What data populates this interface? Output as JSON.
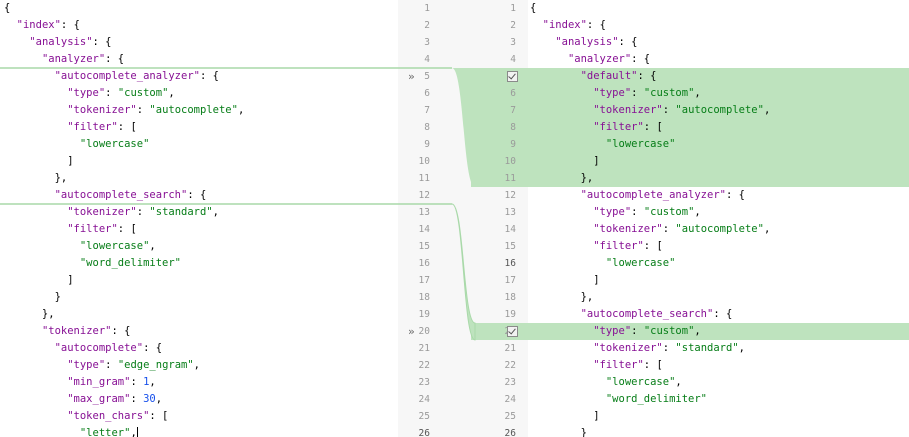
{
  "left": {
    "lines": [
      [
        [
          "p",
          "{"
        ]
      ],
      [
        [
          "p",
          "  "
        ],
        [
          "k",
          "\"index\""
        ],
        [
          "p",
          ": {"
        ]
      ],
      [
        [
          "p",
          "    "
        ],
        [
          "k",
          "\"analysis\""
        ],
        [
          "p",
          ": {"
        ]
      ],
      [
        [
          "p",
          "      "
        ],
        [
          "k",
          "\"analyzer\""
        ],
        [
          "p",
          ": {"
        ]
      ],
      [
        [
          "p",
          "        "
        ],
        [
          "k",
          "\"autocomplete_analyzer\""
        ],
        [
          "p",
          ": {"
        ]
      ],
      [
        [
          "p",
          "          "
        ],
        [
          "k",
          "\"type\""
        ],
        [
          "p",
          ": "
        ],
        [
          "s",
          "\"custom\""
        ],
        [
          "p",
          ","
        ]
      ],
      [
        [
          "p",
          "          "
        ],
        [
          "k",
          "\"tokenizer\""
        ],
        [
          "p",
          ": "
        ],
        [
          "s",
          "\"autocomplete\""
        ],
        [
          "p",
          ","
        ]
      ],
      [
        [
          "p",
          "          "
        ],
        [
          "k",
          "\"filter\""
        ],
        [
          "p",
          ": ["
        ]
      ],
      [
        [
          "p",
          "            "
        ],
        [
          "s",
          "\"lowercase\""
        ]
      ],
      [
        [
          "p",
          "          ]"
        ]
      ],
      [
        [
          "p",
          "        },"
        ]
      ],
      [
        [
          "p",
          "        "
        ],
        [
          "k",
          "\"autocomplete_search\""
        ],
        [
          "p",
          ": {"
        ]
      ],
      [
        [
          "p",
          "          "
        ],
        [
          "k",
          "\"tokenizer\""
        ],
        [
          "p",
          ": "
        ],
        [
          "s",
          "\"standard\""
        ],
        [
          "p",
          ","
        ]
      ],
      [
        [
          "p",
          "          "
        ],
        [
          "k",
          "\"filter\""
        ],
        [
          "p",
          ": ["
        ]
      ],
      [
        [
          "p",
          "            "
        ],
        [
          "s",
          "\"lowercase\""
        ],
        [
          "p",
          ","
        ]
      ],
      [
        [
          "p",
          "            "
        ],
        [
          "s",
          "\"word_delimiter\""
        ]
      ],
      [
        [
          "p",
          "          ]"
        ]
      ],
      [
        [
          "p",
          "        }"
        ]
      ],
      [
        [
          "p",
          "      },"
        ]
      ],
      [
        [
          "p",
          "      "
        ],
        [
          "k",
          "\"tokenizer\""
        ],
        [
          "p",
          ": {"
        ]
      ],
      [
        [
          "p",
          "        "
        ],
        [
          "k",
          "\"autocomplete\""
        ],
        [
          "p",
          ": {"
        ]
      ],
      [
        [
          "p",
          "          "
        ],
        [
          "k",
          "\"type\""
        ],
        [
          "p",
          ": "
        ],
        [
          "s",
          "\"edge_ngram\""
        ],
        [
          "p",
          ","
        ]
      ],
      [
        [
          "p",
          "          "
        ],
        [
          "k",
          "\"min_gram\""
        ],
        [
          "p",
          ": "
        ],
        [
          "n",
          "1"
        ],
        [
          "p",
          ","
        ]
      ],
      [
        [
          "p",
          "          "
        ],
        [
          "k",
          "\"max_gram\""
        ],
        [
          "p",
          ": "
        ],
        [
          "n",
          "30"
        ],
        [
          "p",
          ","
        ]
      ],
      [
        [
          "p",
          "          "
        ],
        [
          "k",
          "\"token_chars\""
        ],
        [
          "p",
          ": ["
        ]
      ],
      [
        [
          "p",
          "            "
        ],
        [
          "s",
          "\"letter\""
        ],
        [
          "p",
          ","
        ]
      ]
    ],
    "line_numbers": [
      "1",
      "2",
      "3",
      "4",
      "5",
      "6",
      "7",
      "8",
      "9",
      "10",
      "11",
      "12",
      "13",
      "14",
      "15",
      "16",
      "17",
      "18",
      "19",
      "20",
      "21",
      "22",
      "23",
      "24",
      "25",
      "26"
    ]
  },
  "right": {
    "lines": [
      [
        [
          "p",
          "{"
        ]
      ],
      [
        [
          "p",
          "  "
        ],
        [
          "k",
          "\"index\""
        ],
        [
          "p",
          ": {"
        ]
      ],
      [
        [
          "p",
          "    "
        ],
        [
          "k",
          "\"analysis\""
        ],
        [
          "p",
          ": {"
        ]
      ],
      [
        [
          "p",
          "      "
        ],
        [
          "k",
          "\"analyzer\""
        ],
        [
          "p",
          ": {"
        ]
      ],
      [
        [
          "p",
          "        "
        ],
        [
          "k",
          "\"default\""
        ],
        [
          "p",
          ": {"
        ]
      ],
      [
        [
          "p",
          "          "
        ],
        [
          "k",
          "\"type\""
        ],
        [
          "p",
          ": "
        ],
        [
          "s",
          "\"custom\""
        ],
        [
          "p",
          ","
        ]
      ],
      [
        [
          "p",
          "          "
        ],
        [
          "k",
          "\"tokenizer\""
        ],
        [
          "p",
          ": "
        ],
        [
          "s",
          "\"autocomplete\""
        ],
        [
          "p",
          ","
        ]
      ],
      [
        [
          "p",
          "          "
        ],
        [
          "k",
          "\"filter\""
        ],
        [
          "p",
          ": ["
        ]
      ],
      [
        [
          "p",
          "            "
        ],
        [
          "s",
          "\"lowercase\""
        ]
      ],
      [
        [
          "p",
          "          ]"
        ]
      ],
      [
        [
          "p",
          "        },"
        ]
      ],
      [
        [
          "p",
          "        "
        ],
        [
          "k",
          "\"autocomplete_analyzer\""
        ],
        [
          "p",
          ": {"
        ]
      ],
      [
        [
          "p",
          "          "
        ],
        [
          "k",
          "\"type\""
        ],
        [
          "p",
          ": "
        ],
        [
          "s",
          "\"custom\""
        ],
        [
          "p",
          ","
        ]
      ],
      [
        [
          "p",
          "          "
        ],
        [
          "k",
          "\"tokenizer\""
        ],
        [
          "p",
          ": "
        ],
        [
          "s",
          "\"autocomplete\""
        ],
        [
          "p",
          ","
        ]
      ],
      [
        [
          "p",
          "          "
        ],
        [
          "k",
          "\"filter\""
        ],
        [
          "p",
          ": ["
        ]
      ],
      [
        [
          "p",
          "            "
        ],
        [
          "s",
          "\"lowercase\""
        ]
      ],
      [
        [
          "p",
          "          ]"
        ]
      ],
      [
        [
          "p",
          "        },"
        ]
      ],
      [
        [
          "p",
          "        "
        ],
        [
          "k",
          "\"autocomplete_search\""
        ],
        [
          "p",
          ": {"
        ]
      ],
      [
        [
          "p",
          "          "
        ],
        [
          "k",
          "\"type\""
        ],
        [
          "p",
          ": "
        ],
        [
          "s",
          "\"custom\""
        ],
        [
          "p",
          ","
        ]
      ],
      [
        [
          "p",
          "          "
        ],
        [
          "k",
          "\"tokenizer\""
        ],
        [
          "p",
          ": "
        ],
        [
          "s",
          "\"standard\""
        ],
        [
          "p",
          ","
        ]
      ],
      [
        [
          "p",
          "          "
        ],
        [
          "k",
          "\"filter\""
        ],
        [
          "p",
          ": ["
        ]
      ],
      [
        [
          "p",
          "            "
        ],
        [
          "s",
          "\"lowercase\""
        ],
        [
          "p",
          ","
        ]
      ],
      [
        [
          "p",
          "            "
        ],
        [
          "s",
          "\"word_delimiter\""
        ]
      ],
      [
        [
          "p",
          "          ]"
        ]
      ],
      [
        [
          "p",
          "        }"
        ]
      ]
    ],
    "line_numbers": [
      "1",
      "2",
      "3",
      "4",
      "5",
      "6",
      "7",
      "8",
      "9",
      "10",
      "11",
      "12",
      "13",
      "14",
      "15",
      "16",
      "17",
      "18",
      "19",
      "20",
      "21",
      "22",
      "23",
      "24",
      "25",
      "26"
    ]
  },
  "diff": {
    "chevron_glyph": "»",
    "highlight_color": "#bee3be",
    "connector_color": "#a9d9a9",
    "changes": [
      {
        "left_after_line": 4,
        "right_lines": [
          5,
          11
        ],
        "icon": "chevron-right-icon",
        "checkbox": "checkbox-icon"
      },
      {
        "left_after_line": 12,
        "right_lines": [
          20,
          20
        ],
        "icon": "chevron-right-icon",
        "checkbox": "checkbox-icon"
      }
    ]
  }
}
